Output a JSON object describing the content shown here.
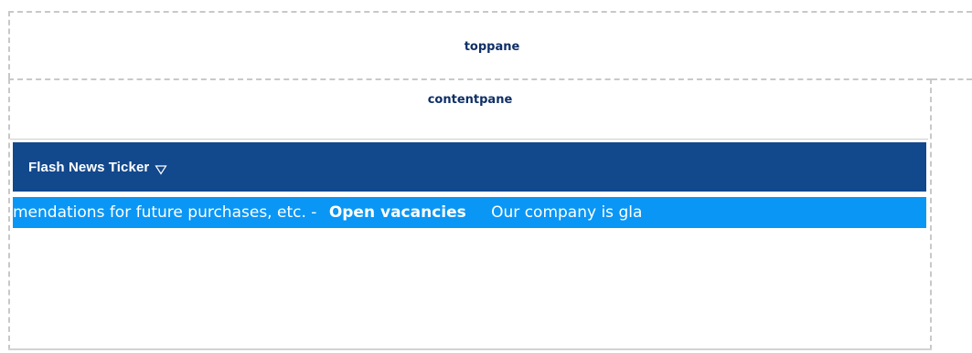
{
  "panes": {
    "top_label": "toppane",
    "content_label": "contentpane"
  },
  "module": {
    "title": "Flash News Ticker",
    "menu_icon": "triangle-down-icon"
  },
  "ticker": {
    "text_before": "mendations for future purchases, etc. -",
    "headline": "Open vacancies",
    "text_after": "Our company is gla"
  },
  "colors": {
    "header_bg": "#12488c",
    "ticker_bg": "#0a96f5",
    "pane_label": "#0f2f66"
  }
}
